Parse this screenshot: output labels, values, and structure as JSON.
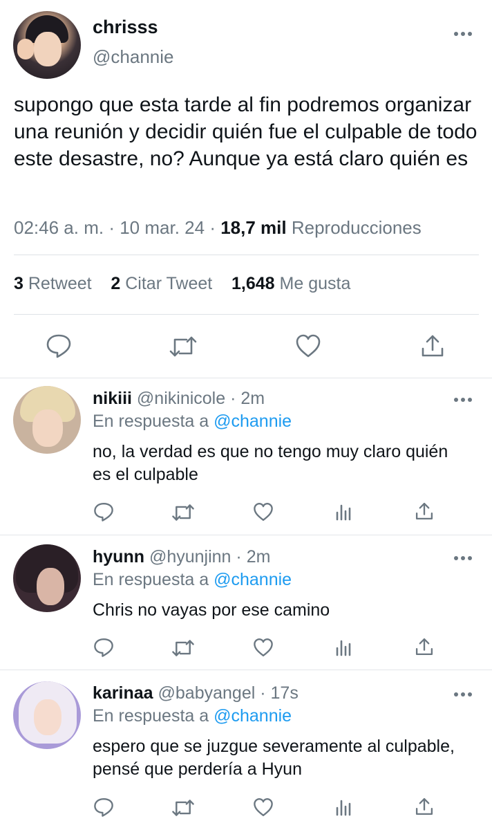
{
  "main_tweet": {
    "display_name": "chrisss",
    "handle": "@channie",
    "text": "supongo que esta tarde al fin podremos organizar una reunión y decidir quién fue el culpable de todo este desastre, no? Aunque ya está claro quién es",
    "time": "02:46 a. m.",
    "date": "10 mar. 24",
    "views_count": "18,7 mil",
    "views_label": "Reproducciones",
    "separator": "·",
    "stats": {
      "retweets_count": "3",
      "retweets_label": "Retweet",
      "quotes_count": "2",
      "quotes_label": "Citar Tweet",
      "likes_count": "1,648",
      "likes_label": "Me gusta"
    }
  },
  "replies": [
    {
      "display_name": "nikiii",
      "handle": "@nikinicole",
      "time": "2m",
      "reply_prefix": "En respuesta a",
      "reply_to": "@channie",
      "text": "no, la verdad es que no tengo muy claro quién es el culpable"
    },
    {
      "display_name": "hyunn",
      "handle": "@hyunjinn",
      "time": "2m",
      "reply_prefix": "En respuesta a",
      "reply_to": "@channie",
      "text": "Chris no vayas por ese camino"
    },
    {
      "display_name": "karinaa",
      "handle": "@babyangel",
      "time": "17s",
      "reply_prefix": "En respuesta a",
      "reply_to": "@channie",
      "text": "espero que se juzgue severamente al culpable, pensé que perdería a Hyun"
    }
  ],
  "icons": {
    "reply": "reply-icon",
    "retweet": "retweet-icon",
    "like": "like-icon",
    "views": "views-icon",
    "share": "share-icon",
    "more": "more-icon"
  },
  "colors": {
    "text": "#0f1419",
    "secondary": "#6b7781",
    "link": "#1d9bf0",
    "divider": "#e3e6e9"
  }
}
